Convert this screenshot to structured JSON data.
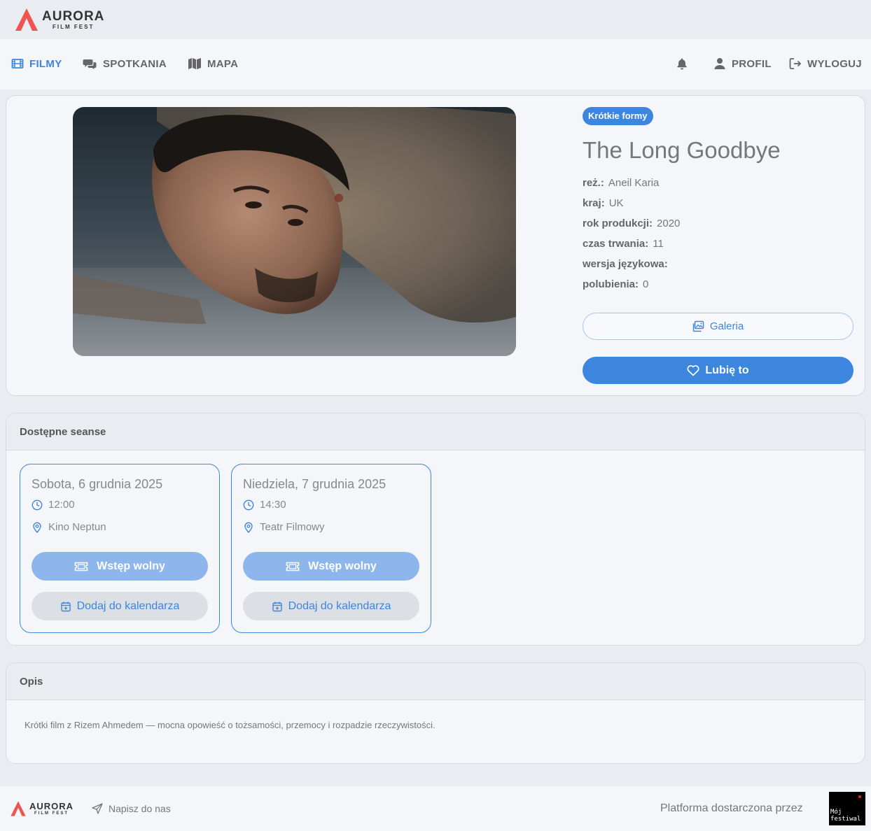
{
  "brand": {
    "name": "AURORA",
    "sub": "FILM FEST",
    "accent": "#f05350"
  },
  "nav": {
    "films": "FILMY",
    "meetings": "SPOTKANIA",
    "map": "MAPA",
    "profile": "PROFIL",
    "logout": "WYLOGUJ"
  },
  "film": {
    "category": "Krótkie formy",
    "title": "The Long Goodbye",
    "meta": [
      {
        "label": "reż.:",
        "value": "Aneil Karia"
      },
      {
        "label": "kraj:",
        "value": "UK"
      },
      {
        "label": "rok produkcji:",
        "value": "2020"
      },
      {
        "label": "czas trwania:",
        "value": "11"
      },
      {
        "label": "wersja językowa:",
        "value": ""
      },
      {
        "label": "polubienia:",
        "value": "0"
      }
    ],
    "gallery_label": "Galeria",
    "like_label": "Lubię to"
  },
  "screenings": {
    "heading": "Dostępne seanse",
    "items": [
      {
        "date": "Sobota, 6 grudnia 2025",
        "time": "12:00",
        "venue": "Kino Neptun",
        "entry": "Wstęp wolny",
        "calendar": "Dodaj do kalendarza"
      },
      {
        "date": "Niedziela, 7 grudnia 2025",
        "time": "14:30",
        "venue": "Teatr Filmowy",
        "entry": "Wstęp wolny",
        "calendar": "Dodaj do kalendarza"
      }
    ]
  },
  "description": {
    "heading": "Opis",
    "text": "Krótki film z Rizem Ahmedem — mocna opowieść o tożsamości, przemocy i rozpadzie rzeczywistości."
  },
  "footer": {
    "contact": "Napisz do nas",
    "powered": "Platforma dostarczona przez",
    "partner_logo_text": "Mój festiwal"
  },
  "colors": {
    "primary": "#3d86df",
    "primary_light": "#8db7ec",
    "background": "#e9ecf1",
    "surface": "#f4f6f9"
  }
}
